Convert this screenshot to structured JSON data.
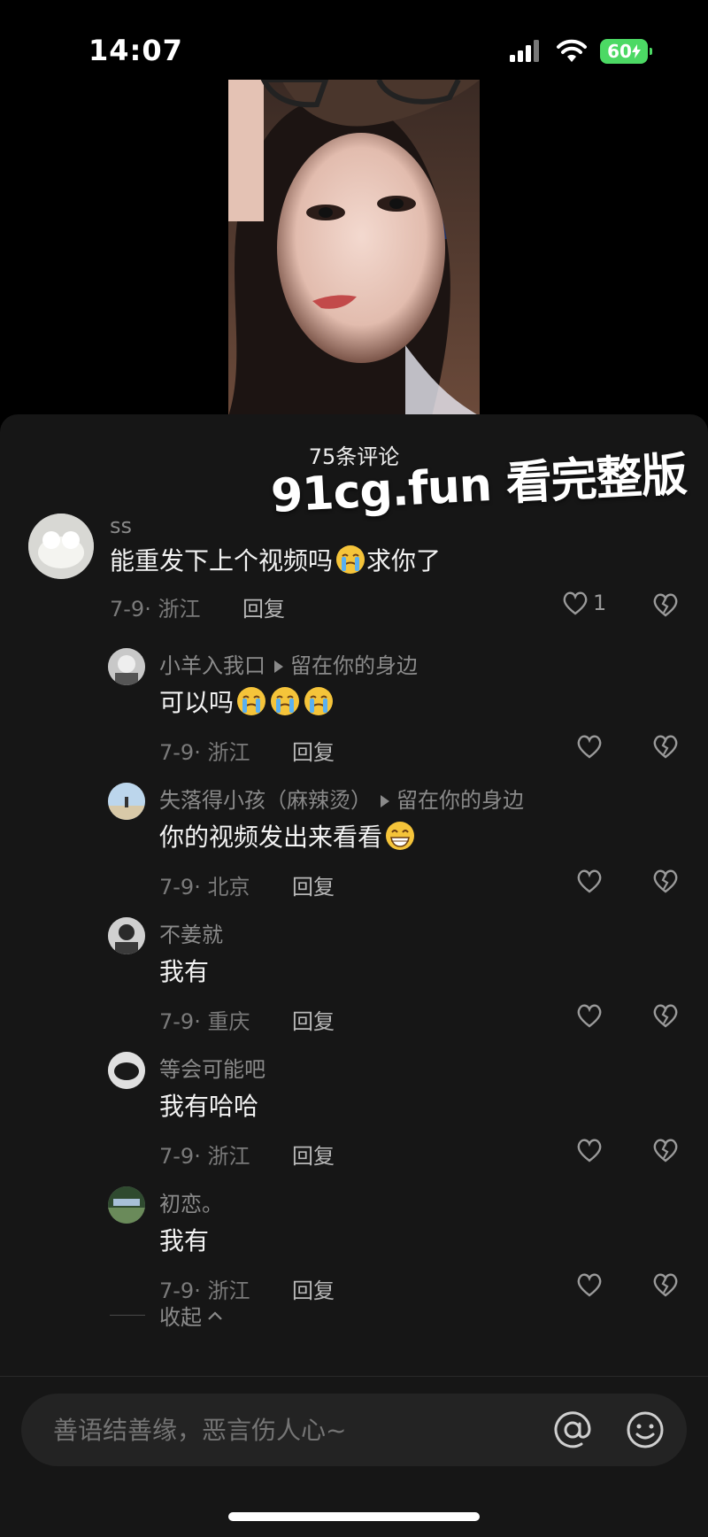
{
  "status_bar": {
    "time": "14:07",
    "battery": "60"
  },
  "sheet": {
    "title": "75条评论",
    "watermark": "91cg.fun 看完整版"
  },
  "comments": [
    {
      "user": "ss",
      "text": "能重发下上个视频吗",
      "emoji": "crying-face-emoji",
      "text_after": "求你了",
      "meta": "7-9· 浙江",
      "reply_label": "回复",
      "like_count": "1"
    },
    {
      "user": "小羊入我口",
      "reply_to": "留在你的身边",
      "text": "可以吗",
      "emoji_count": 3,
      "emoji": "crying-face-emoji",
      "meta": "7-9· 浙江",
      "reply_label": "回复"
    },
    {
      "user": "失落得小孩（麻辣烫）",
      "reply_to": "留在你的身边",
      "text": "你的视频发出来看看",
      "emoji": "grinning-face-emoji",
      "meta": "7-9· 北京",
      "reply_label": "回复"
    },
    {
      "user": "不姜就",
      "text": "我有",
      "meta": "7-9· 重庆",
      "reply_label": "回复"
    },
    {
      "user": "等会可能吧",
      "text": "我有哈哈",
      "meta": "7-9· 浙江",
      "reply_label": "回复"
    },
    {
      "user": "初恋。",
      "text": "我有",
      "meta": "7-9· 浙江",
      "reply_label": "回复"
    }
  ],
  "collapse_label": "收起",
  "input": {
    "placeholder": "善语结善缘，恶言伤人心~"
  },
  "colors": {
    "sheet_bg": "#161616",
    "battery": "#4cd964",
    "meta_gray": "#7a7a7a"
  }
}
